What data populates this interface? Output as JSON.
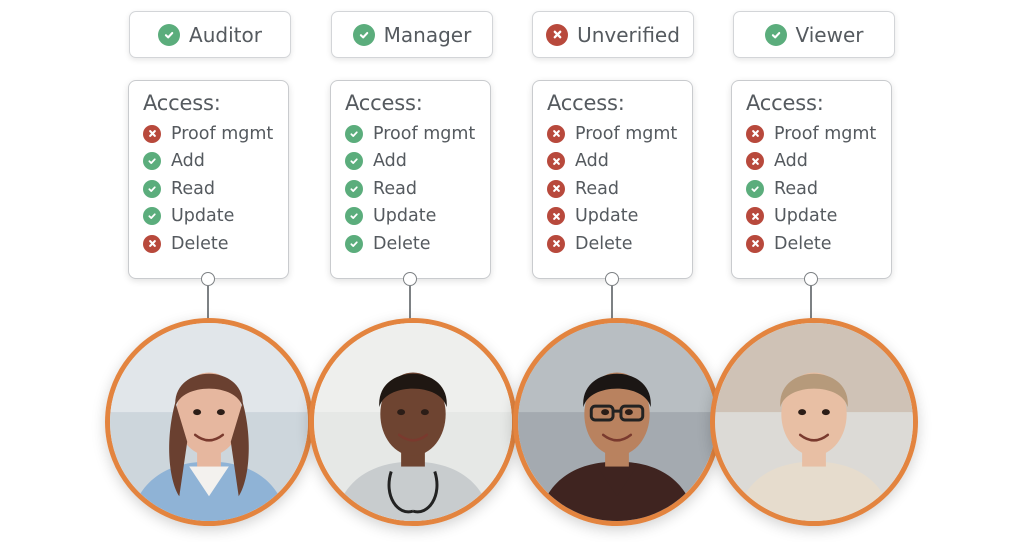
{
  "access_label": "Access:",
  "colors": {
    "granted": "#5bad7c",
    "denied": "#b8493c",
    "ring": "#e3843f",
    "text": "#555a5f"
  },
  "roles": [
    {
      "name": "Auditor",
      "verified": true,
      "status_icon": "check-circle-icon",
      "person": "female-healthcare-worker-in-blue-scrubs",
      "permissions": [
        {
          "label": "Proof mgmt",
          "granted": false
        },
        {
          "label": "Add",
          "granted": true
        },
        {
          "label": "Read",
          "granted": true
        },
        {
          "label": "Update",
          "granted": true
        },
        {
          "label": "Delete",
          "granted": false
        }
      ]
    },
    {
      "name": "Manager",
      "verified": true,
      "status_icon": "check-circle-icon",
      "person": "male-doctor-with-stethoscope",
      "permissions": [
        {
          "label": "Proof mgmt",
          "granted": true
        },
        {
          "label": "Add",
          "granted": true
        },
        {
          "label": "Read",
          "granted": true
        },
        {
          "label": "Update",
          "granted": true
        },
        {
          "label": "Delete",
          "granted": true
        }
      ]
    },
    {
      "name": "Unverified",
      "verified": false,
      "status_icon": "x-circle-icon",
      "person": "smiling-man-with-glasses",
      "permissions": [
        {
          "label": "Proof mgmt",
          "granted": false
        },
        {
          "label": "Add",
          "granted": false
        },
        {
          "label": "Read",
          "granted": false
        },
        {
          "label": "Update",
          "granted": false
        },
        {
          "label": "Delete",
          "granted": false
        }
      ]
    },
    {
      "name": "Viewer",
      "verified": true,
      "status_icon": "check-circle-icon",
      "person": "smiling-young-man-blond-hair",
      "permissions": [
        {
          "label": "Proof mgmt",
          "granted": false
        },
        {
          "label": "Add",
          "granted": false
        },
        {
          "label": "Read",
          "granted": true
        },
        {
          "label": "Update",
          "granted": false
        },
        {
          "label": "Delete",
          "granted": false
        }
      ]
    }
  ]
}
